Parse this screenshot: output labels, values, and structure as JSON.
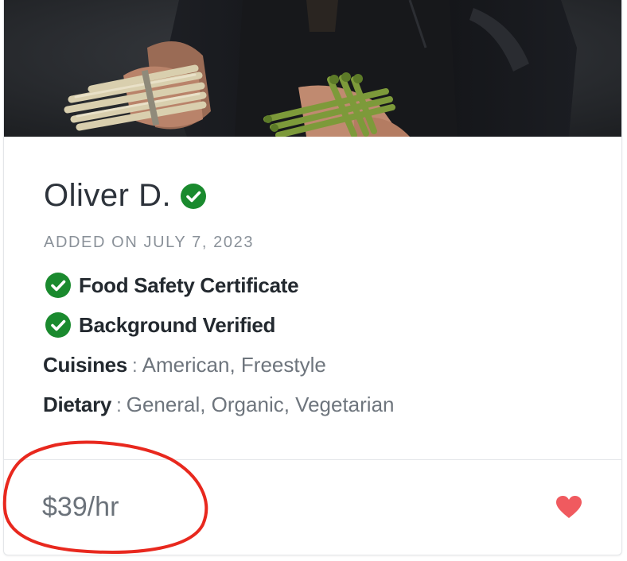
{
  "chef": {
    "name": "Oliver D.",
    "added_on": "ADDED ON JULY 7, 2023"
  },
  "certifications": [
    {
      "label": "Food Safety Certificate",
      "icon": "check-circle-icon"
    },
    {
      "label": "Background Verified",
      "icon": "check-circle-icon"
    }
  ],
  "details": {
    "cuisines": {
      "key": "Cuisines",
      "separator": ":",
      "value": "American, Freestyle"
    },
    "dietary": {
      "key": "Dietary",
      "separator": ":",
      "value": "General, Organic, Vegetarian"
    }
  },
  "footer": {
    "price": "$39/hr",
    "favorite_icon": "heart-icon"
  },
  "colors": {
    "verified_green": "#1a8a2e",
    "heart_red": "#f05a5f",
    "annotation_red": "#e8281e",
    "name_text": "#2d333b"
  }
}
